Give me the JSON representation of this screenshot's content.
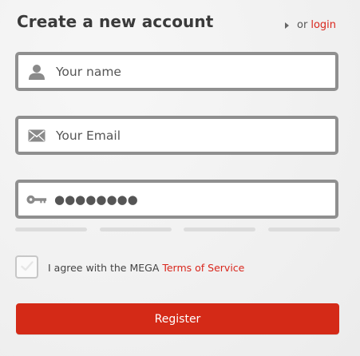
{
  "header": {
    "title": "Create a new account",
    "or_text": "or",
    "login_label": "login"
  },
  "form": {
    "name_placeholder": "Your name",
    "email_placeholder": "Your Email",
    "password_value": "●●●●●●●●",
    "password_strength_segments": 4,
    "agree_text": "I agree with the MEGA",
    "terms_label": "Terms of Service",
    "agree_checked": false,
    "register_label": "Register"
  },
  "icons": {
    "name": "user-icon",
    "email": "envelope-icon",
    "password": "key-icon",
    "checkbox": "check-icon",
    "login_arrow": "triangle-right-icon"
  },
  "colors": {
    "accent": "#d9261c",
    "button": "#d42a17",
    "field_border": "#8f8f8f",
    "icon": "#8a8a8a"
  }
}
